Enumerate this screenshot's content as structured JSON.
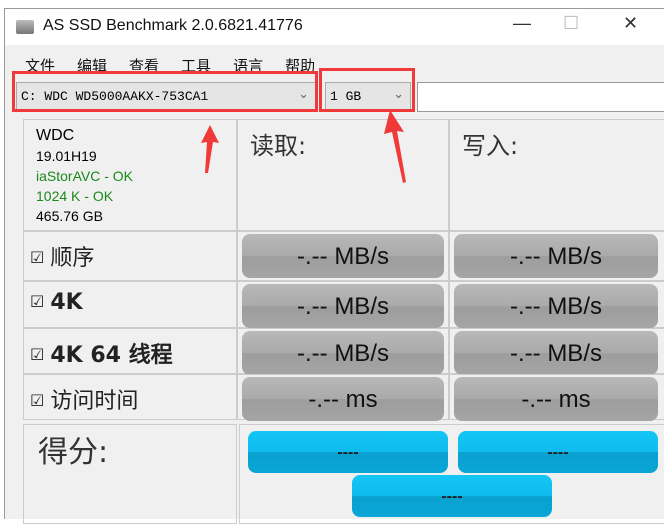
{
  "window": {
    "title": "AS SSD Benchmark 2.0.6821.41776",
    "minimize": "—",
    "maximize": "☐",
    "close": "✕"
  },
  "menu": [
    "文件",
    "编辑",
    "查看",
    "工具",
    "语言",
    "帮助"
  ],
  "toolbar": {
    "drive": "C: WDC WD5000AAKX-753CA1",
    "size": "1 GB",
    "extra": ""
  },
  "drive_info": {
    "vendor": "WDC",
    "firmware": "19.01H19",
    "driver": "iaStorAVC - OK",
    "alignment": "1024 K - OK",
    "capacity": "465.76 GB"
  },
  "headers": {
    "read": "读取:",
    "write": "写入:"
  },
  "rows": [
    {
      "label": "顺序",
      "read": "-.-- MB/s",
      "write": "-.-- MB/s"
    },
    {
      "label": "4K",
      "read": "-.-- MB/s",
      "write": "-.-- MB/s"
    },
    {
      "label": "4K 64 线程",
      "read": "-.-- MB/s",
      "write": "-.-- MB/s"
    },
    {
      "label": "访问时间",
      "read": "-.-- ms",
      "write": "-.-- ms"
    }
  ],
  "score": {
    "label": "得分:",
    "read": "----",
    "write": "----",
    "total": "----"
  },
  "colors": {
    "ok": "#1a8a1a",
    "score": "#10bbee",
    "annotation": "#f03a3a"
  }
}
